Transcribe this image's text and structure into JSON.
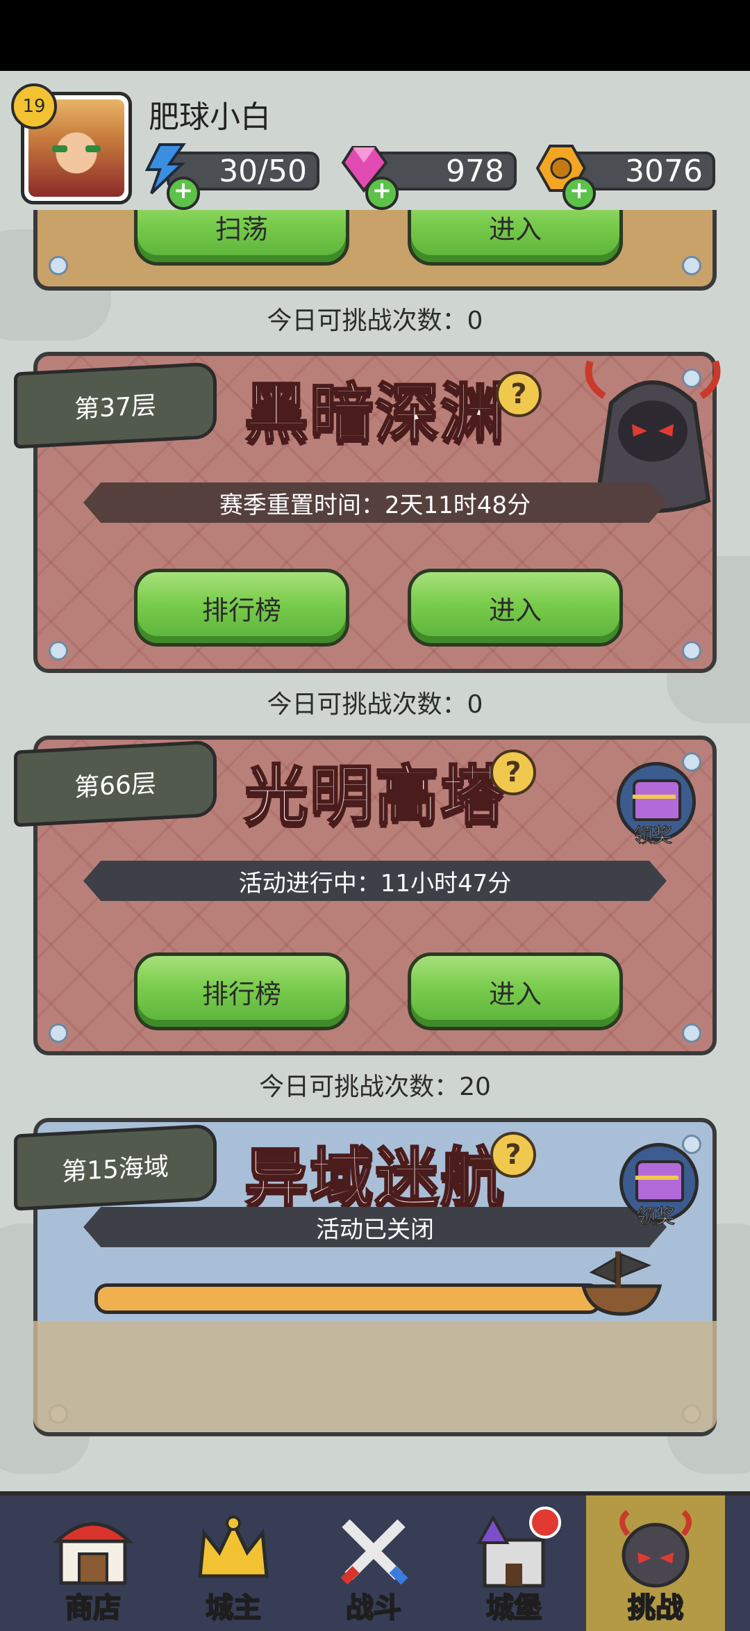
{
  "header": {
    "level": "19",
    "username": "肥球小白",
    "energy": "30/50",
    "gems": "978",
    "gold": "3076"
  },
  "top_card": {
    "sweep_label": "扫荡",
    "enter_label": "进入"
  },
  "attempts_top": "今日可挑战次数：0",
  "abyss": {
    "floor": "第37层",
    "title": "黑暗深渊",
    "status": "赛季重置时间：2天11时48分",
    "rank_label": "排行榜",
    "enter_label": "进入",
    "attempts": "今日可挑战次数：0"
  },
  "tower": {
    "floor": "第66层",
    "title": "光明高塔",
    "status": "活动进行中：11小时47分",
    "reward_label": "领奖",
    "rank_label": "排行榜",
    "enter_label": "进入",
    "attempts": "今日可挑战次数：20"
  },
  "voyage": {
    "floor": "第15海域",
    "title": "异域迷航",
    "status": "活动已关闭",
    "reward_label": "领奖"
  },
  "nav": {
    "shop": "商店",
    "lord": "城主",
    "battle": "战斗",
    "castle": "城堡",
    "challenge": "挑战"
  },
  "colors": {
    "button_green": "#79cc4b",
    "card_red": "#b9807a",
    "card_blue": "#a9bfd8",
    "nav_bg": "#363d54",
    "nav_active": "#b59a45"
  }
}
